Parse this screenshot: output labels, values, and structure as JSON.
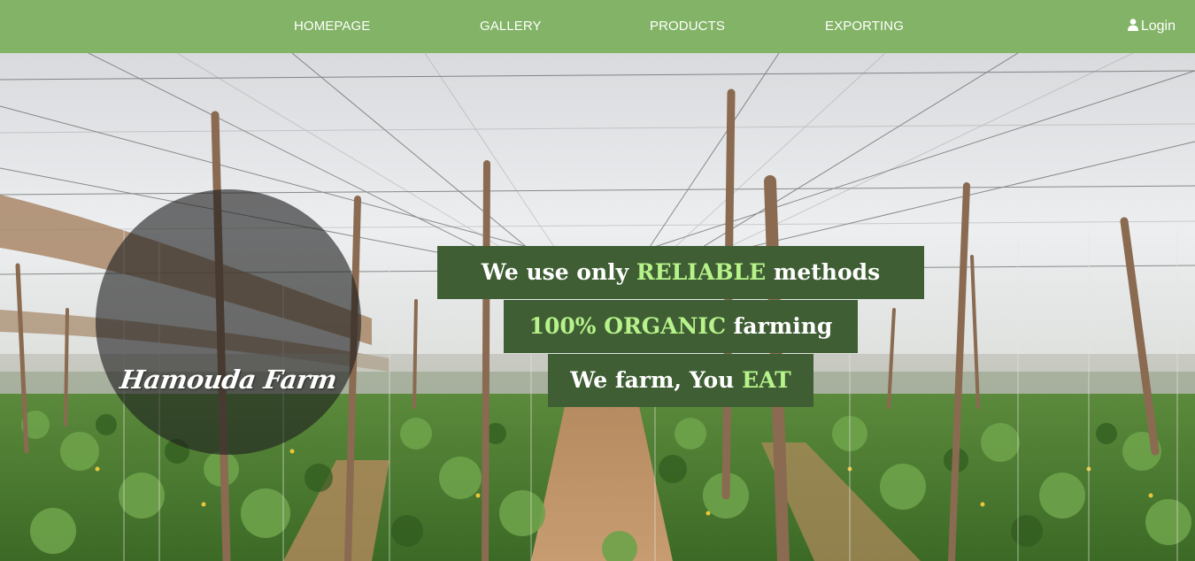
{
  "nav": {
    "items": [
      {
        "label": "HOMEPAGE"
      },
      {
        "label": "GALLERY"
      },
      {
        "label": "PRODUCTS"
      },
      {
        "label": "EXPORTING"
      }
    ],
    "login_label": "Login",
    "login_icon": "user-icon",
    "background_color": "#82b366"
  },
  "hero": {
    "logo_text": "Hamouda Farm",
    "banners": [
      {
        "pre": "We use only ",
        "highlight": "RELIABLE",
        "post": " methods"
      },
      {
        "pre": "",
        "highlight": "100% ORGANIC",
        "post": " farming"
      },
      {
        "pre": "We farm, You ",
        "highlight": "EAT",
        "post": ""
      }
    ],
    "banner_color": "#3f5e34",
    "highlight_color": "#b7f28a"
  }
}
